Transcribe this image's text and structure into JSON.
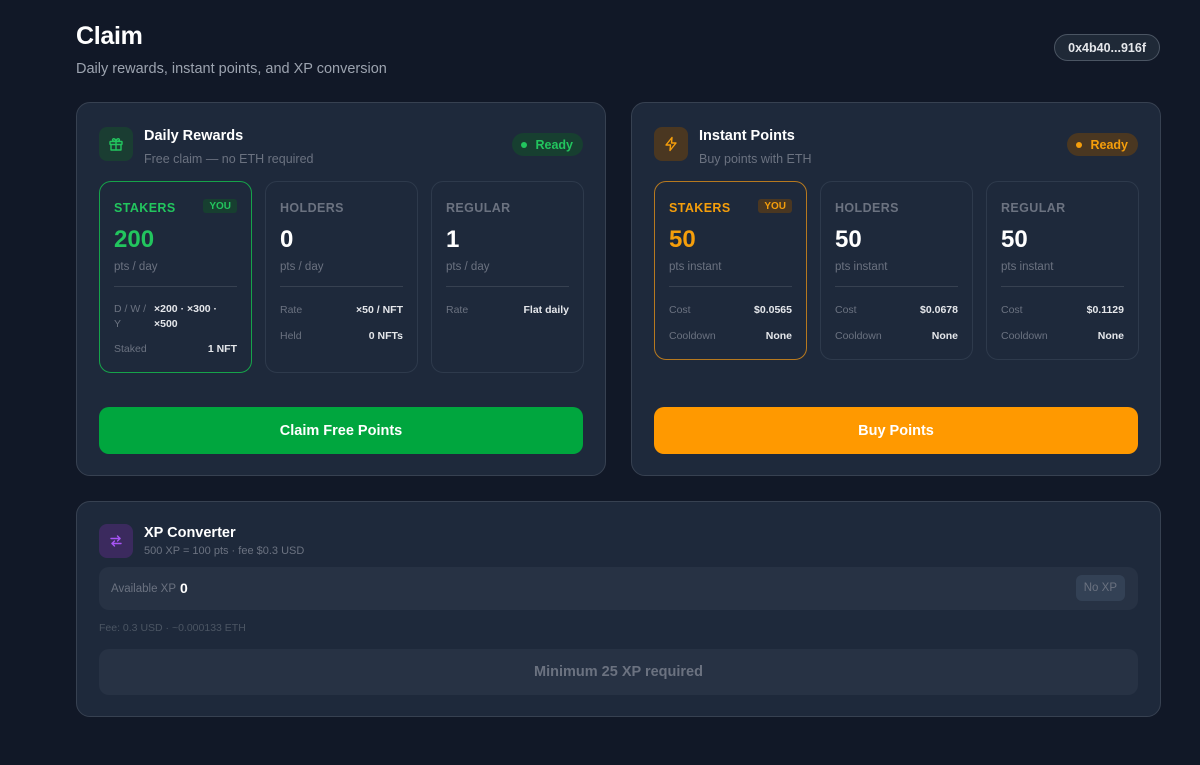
{
  "header": {
    "title": "Claim",
    "subtitle": "Daily rewards, instant points, and XP conversion",
    "wallet": "0x4b40...916f"
  },
  "daily": {
    "title": "Daily Rewards",
    "subtitle": "Free claim — no ETH required",
    "status": "Ready",
    "accent": "#22c55e",
    "icon": "gift-icon",
    "tiers": [
      {
        "name": "STAKERS",
        "you_badge": "YOU",
        "value": "200",
        "unit": "pts / day",
        "dwy_label": "D / W / Y",
        "dwy_value": "×200 · ×300 · ×500",
        "rows": [
          {
            "label": "Staked",
            "value": "1 NFT"
          }
        ]
      },
      {
        "name": "HOLDERS",
        "value": "0",
        "unit": "pts / day",
        "rows": [
          {
            "label": "Rate",
            "value": "×50 / NFT"
          },
          {
            "label": "Held",
            "value": "0 NFTs"
          }
        ]
      },
      {
        "name": "REGULAR",
        "value": "1",
        "unit": "pts / day",
        "rows": [
          {
            "label": "Rate",
            "value": "Flat daily"
          }
        ]
      }
    ],
    "button": "Claim Free Points"
  },
  "instant": {
    "title": "Instant Points",
    "subtitle": "Buy points with ETH",
    "status": "Ready",
    "accent": "#f59e0b",
    "icon": "lightning-icon",
    "tiers": [
      {
        "name": "STAKERS",
        "you_badge": "YOU",
        "value": "50",
        "unit": "pts instant",
        "rows": [
          {
            "label": "Cost",
            "value": "$0.0565"
          },
          {
            "label": "Cooldown",
            "value": "None"
          }
        ]
      },
      {
        "name": "HOLDERS",
        "value": "50",
        "unit": "pts instant",
        "rows": [
          {
            "label": "Cost",
            "value": "$0.0678"
          },
          {
            "label": "Cooldown",
            "value": "None"
          }
        ]
      },
      {
        "name": "REGULAR",
        "value": "50",
        "unit": "pts instant",
        "rows": [
          {
            "label": "Cost",
            "value": "$0.1129"
          },
          {
            "label": "Cooldown",
            "value": "None"
          }
        ]
      }
    ],
    "button": "Buy Points"
  },
  "xp": {
    "title": "XP Converter",
    "subtitle": "500 XP = 100 pts · fee $0.3 USD",
    "icon": "swap-arrows-icon",
    "available_label": "Available XP",
    "available_value": "0",
    "no_xp": "No XP",
    "fee_note": "Fee: 0.3 USD · ~0.000133 ETH",
    "button": "Minimum 25 XP required"
  },
  "colors": {
    "background": "#111827",
    "card": "#1e293b",
    "green": "#22c55e",
    "green_button": "#00a63e",
    "orange": "#f59e0b",
    "orange_button": "#ff9900",
    "purple": "#a855f7"
  }
}
